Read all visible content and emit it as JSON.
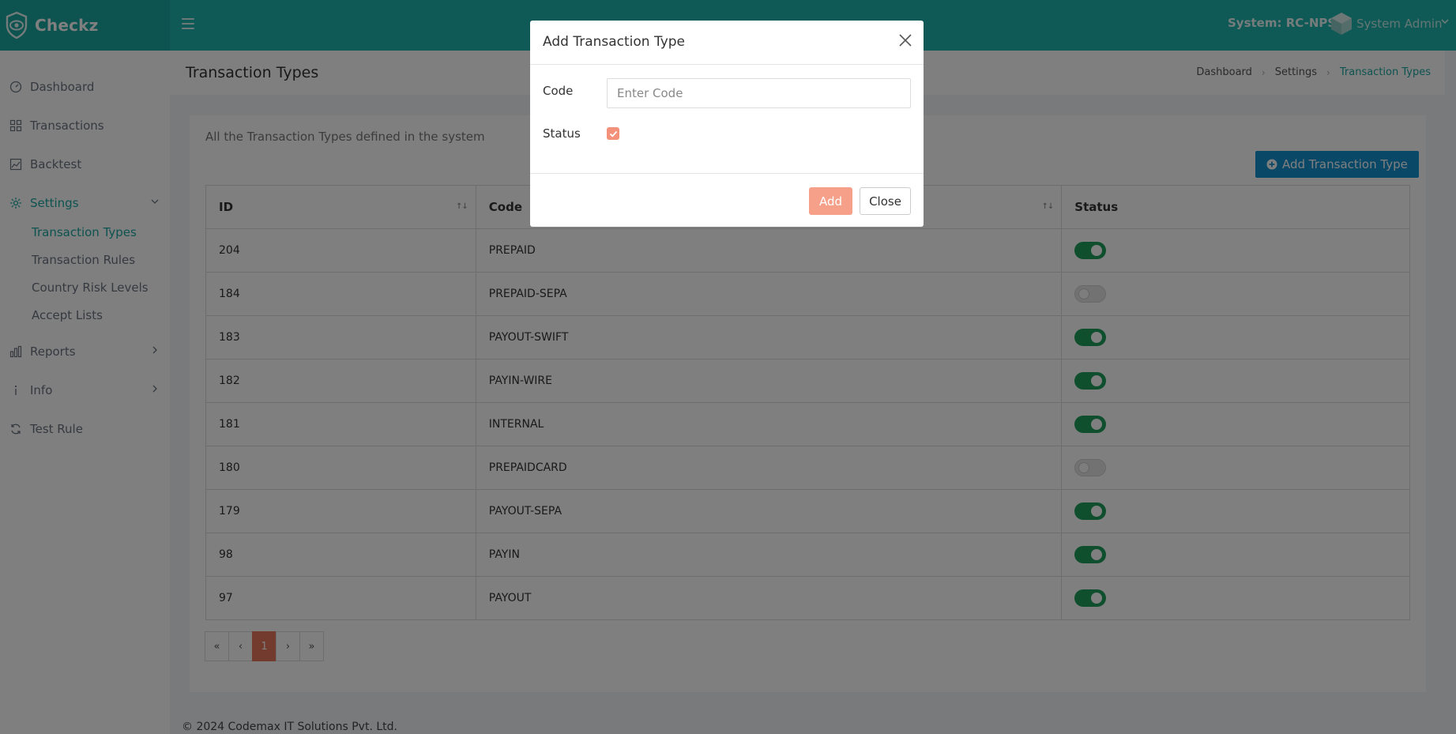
{
  "header": {
    "brand": "Checkz",
    "system_label": "System: RC-NPS",
    "user_name": "System Admin"
  },
  "sidebar": {
    "items": [
      {
        "label": "Dashboard",
        "icon": "speedometer-icon"
      },
      {
        "label": "Transactions",
        "icon": "grid-icon"
      },
      {
        "label": "Backtest",
        "icon": "image-chart-icon"
      },
      {
        "label": "Settings",
        "icon": "gear-icon",
        "expanded": true
      },
      {
        "label": "Reports",
        "icon": "bar-chart-icon"
      },
      {
        "label": "Info",
        "icon": "info-icon"
      },
      {
        "label": "Test Rule",
        "icon": "refresh-icon"
      }
    ],
    "settings_sub": [
      "Transaction Types",
      "Transaction Rules",
      "Country Risk Levels",
      "Accept Lists"
    ]
  },
  "page": {
    "title": "Transaction Types",
    "breadcrumb": [
      "Dashboard",
      "Settings",
      "Transaction Types"
    ],
    "description": "All the Transaction Types defined in the system",
    "add_button": "Add Transaction Type"
  },
  "table": {
    "headers": [
      "ID",
      "Code",
      "Status"
    ],
    "rows": [
      {
        "id": "204",
        "code": "PREPAID",
        "status": true
      },
      {
        "id": "184",
        "code": "PREPAID-SEPA",
        "status": false
      },
      {
        "id": "183",
        "code": "PAYOUT-SWIFT",
        "status": true
      },
      {
        "id": "182",
        "code": "PAYIN-WIRE",
        "status": true
      },
      {
        "id": "181",
        "code": "INTERNAL",
        "status": true
      },
      {
        "id": "180",
        "code": "PREPAIDCARD",
        "status": false
      },
      {
        "id": "179",
        "code": "PAYOUT-SEPA",
        "status": true
      },
      {
        "id": "98",
        "code": "PAYIN",
        "status": true
      },
      {
        "id": "97",
        "code": "PAYOUT",
        "status": true
      }
    ]
  },
  "pagination": {
    "first": "«",
    "prev": "‹",
    "current": "1",
    "next": "›",
    "last": "»"
  },
  "footer": "© 2024 Codemax IT Solutions Pvt. Ltd.",
  "modal": {
    "title": "Add Transaction Type",
    "code_label": "Code",
    "code_placeholder": "Enter Code",
    "code_value": "",
    "status_label": "Status",
    "status_checked": true,
    "add_label": "Add",
    "close_label": "Close"
  },
  "colors": {
    "header": "#1fb4ad",
    "accent": "#1aa7a1",
    "toggle_on": "#1f9e5a",
    "primary_button": "#1591d1",
    "page_active": "#e5765a"
  }
}
